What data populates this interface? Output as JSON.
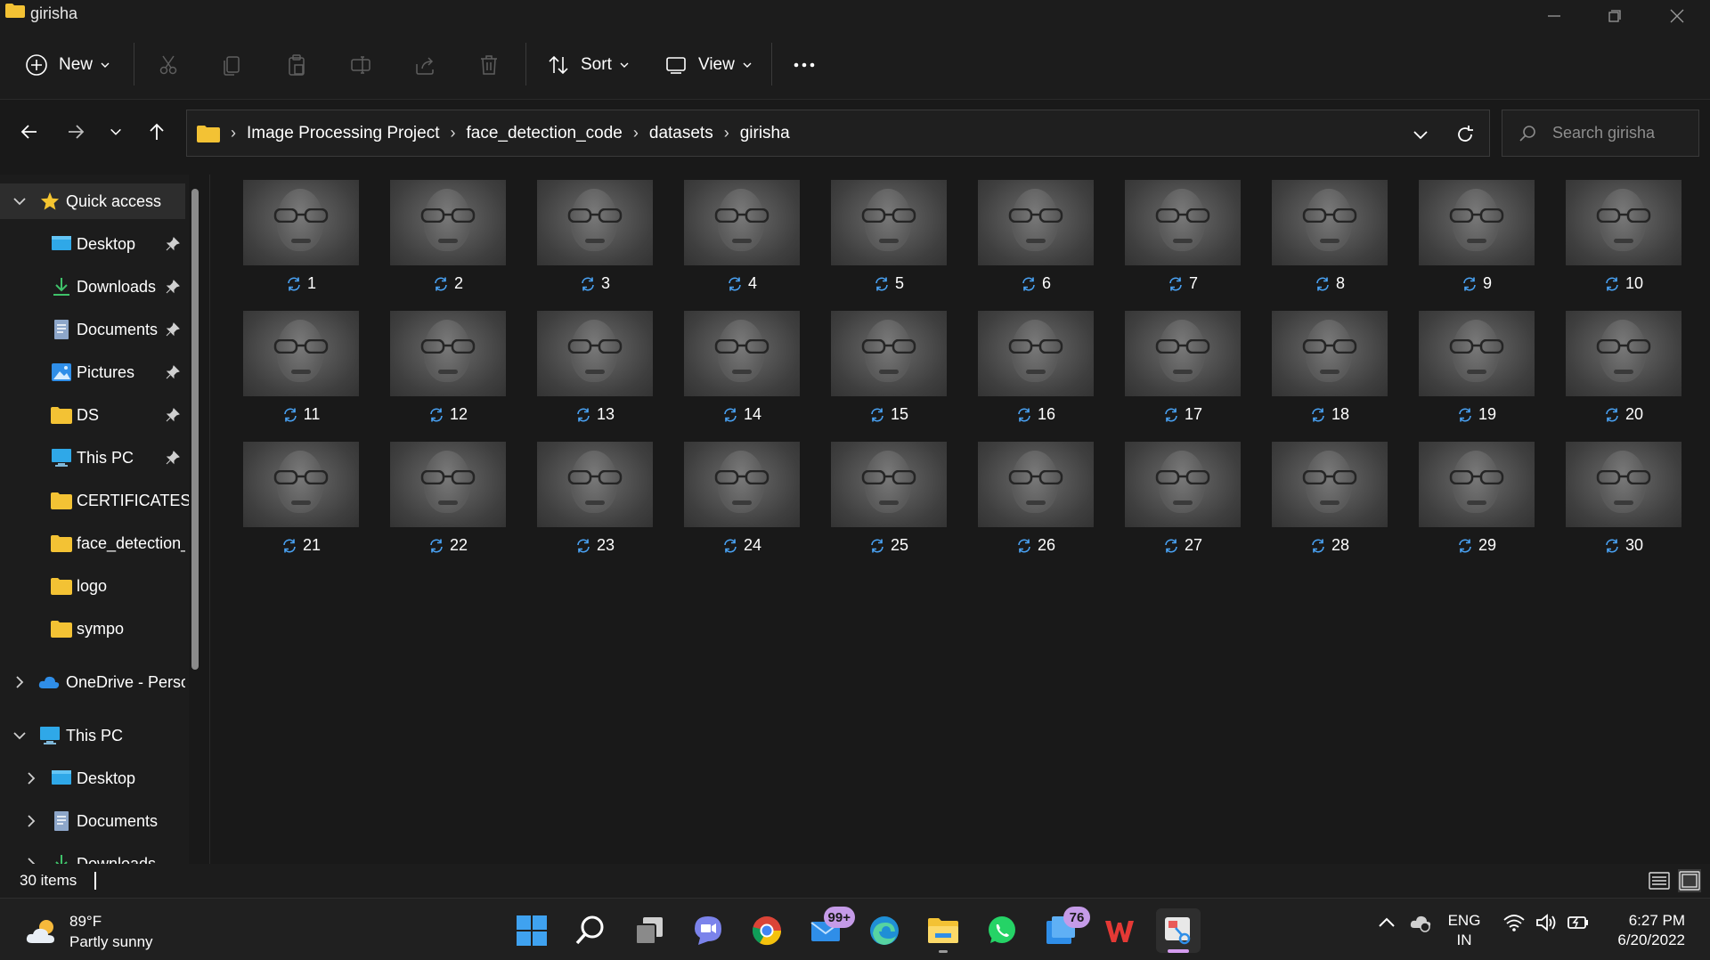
{
  "window": {
    "title": "girisha",
    "icons": {
      "app": "folder-icon",
      "minimize": "minimize-icon",
      "restore": "restore-icon",
      "close": "close-icon"
    }
  },
  "toolbar": {
    "new_label": "New",
    "sort_label": "Sort",
    "view_label": "View",
    "commands": [
      "cut-icon",
      "copy-icon",
      "paste-icon",
      "rename-icon",
      "share-icon",
      "delete-icon",
      "more-icon"
    ]
  },
  "address": {
    "crumbs": [
      "Image Processing Project",
      "face_detection_code",
      "datasets",
      "girisha"
    ]
  },
  "search": {
    "placeholder": "Search girisha"
  },
  "sidebar": {
    "quick_access": "Quick access",
    "items": [
      {
        "label": "Desktop",
        "icon": "desktop-icon",
        "pinned": true
      },
      {
        "label": "Downloads",
        "icon": "downloads-icon",
        "pinned": true
      },
      {
        "label": "Documents",
        "icon": "documents-icon",
        "pinned": true
      },
      {
        "label": "Pictures",
        "icon": "pictures-icon",
        "pinned": true
      },
      {
        "label": "DS",
        "icon": "folder-icon",
        "pinned": true
      },
      {
        "label": "This PC",
        "icon": "pc-icon",
        "pinned": true
      },
      {
        "label": "CERTIFICATES",
        "icon": "folder-icon",
        "pinned": false
      },
      {
        "label": "face_detection_",
        "icon": "folder-icon",
        "pinned": false
      },
      {
        "label": "logo",
        "icon": "folder-icon",
        "pinned": false
      },
      {
        "label": "sympo",
        "icon": "folder-icon",
        "pinned": false
      }
    ],
    "onedrive": "OneDrive - Perso",
    "this_pc": "This PC",
    "pc_children": [
      "Desktop",
      "Documents",
      "Downloads"
    ]
  },
  "files": [
    "1",
    "2",
    "3",
    "4",
    "5",
    "6",
    "7",
    "8",
    "9",
    "10",
    "11",
    "12",
    "13",
    "14",
    "15",
    "16",
    "17",
    "18",
    "19",
    "20",
    "21",
    "22",
    "23",
    "24",
    "25",
    "26",
    "27",
    "28",
    "29",
    "30"
  ],
  "status": {
    "count": "30 items"
  },
  "taskbar": {
    "weather_temp": "89°F",
    "weather_desc": "Partly sunny",
    "mail_badge": "99+",
    "teams_badge": "76",
    "lang_1": "ENG",
    "lang_2": "IN",
    "time": "6:27 PM",
    "date": "6/20/2022"
  },
  "colors": {
    "accent": "#4aa3f5",
    "background": "#191919",
    "badge": "#c59be8"
  }
}
